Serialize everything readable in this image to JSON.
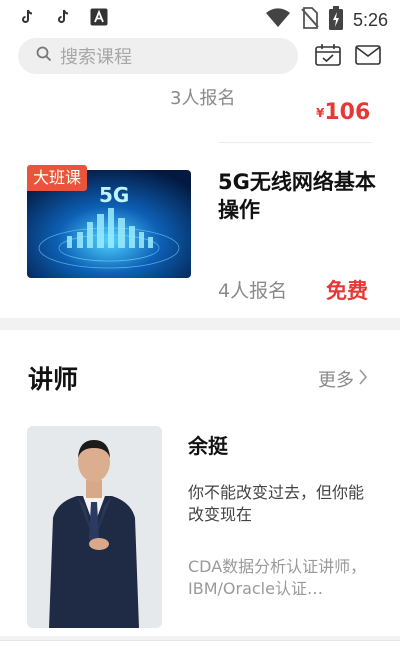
{
  "status_bar": {
    "time": "5:26",
    "left_icons": [
      "tiktok-icon",
      "tiktok-icon",
      "font-icon"
    ],
    "right_icons": [
      "wifi-icon",
      "no-sim-icon",
      "battery-charging-icon"
    ]
  },
  "search": {
    "placeholder": "搜索课程",
    "icons": [
      "calendar-check-icon",
      "mail-icon"
    ]
  },
  "courses": [
    {
      "enroll_text": "3人报名",
      "price_symbol": "¥",
      "price": "106"
    },
    {
      "badge": "大班课",
      "thumb_text": "5G",
      "title": "5G无线网络基本操作",
      "enroll_text": "4人报名",
      "price_label": "免费"
    }
  ],
  "teachers_section": {
    "title": "讲师",
    "more_label": "更多",
    "teacher": {
      "name": "余挺",
      "quote": "你不能改变过去，但你能改变现在",
      "desc": "CDA数据分析认证讲师，IBM/Oracle认证…"
    }
  },
  "colors": {
    "accent_red": "#e53935",
    "badge_orange": "#e8553a"
  }
}
